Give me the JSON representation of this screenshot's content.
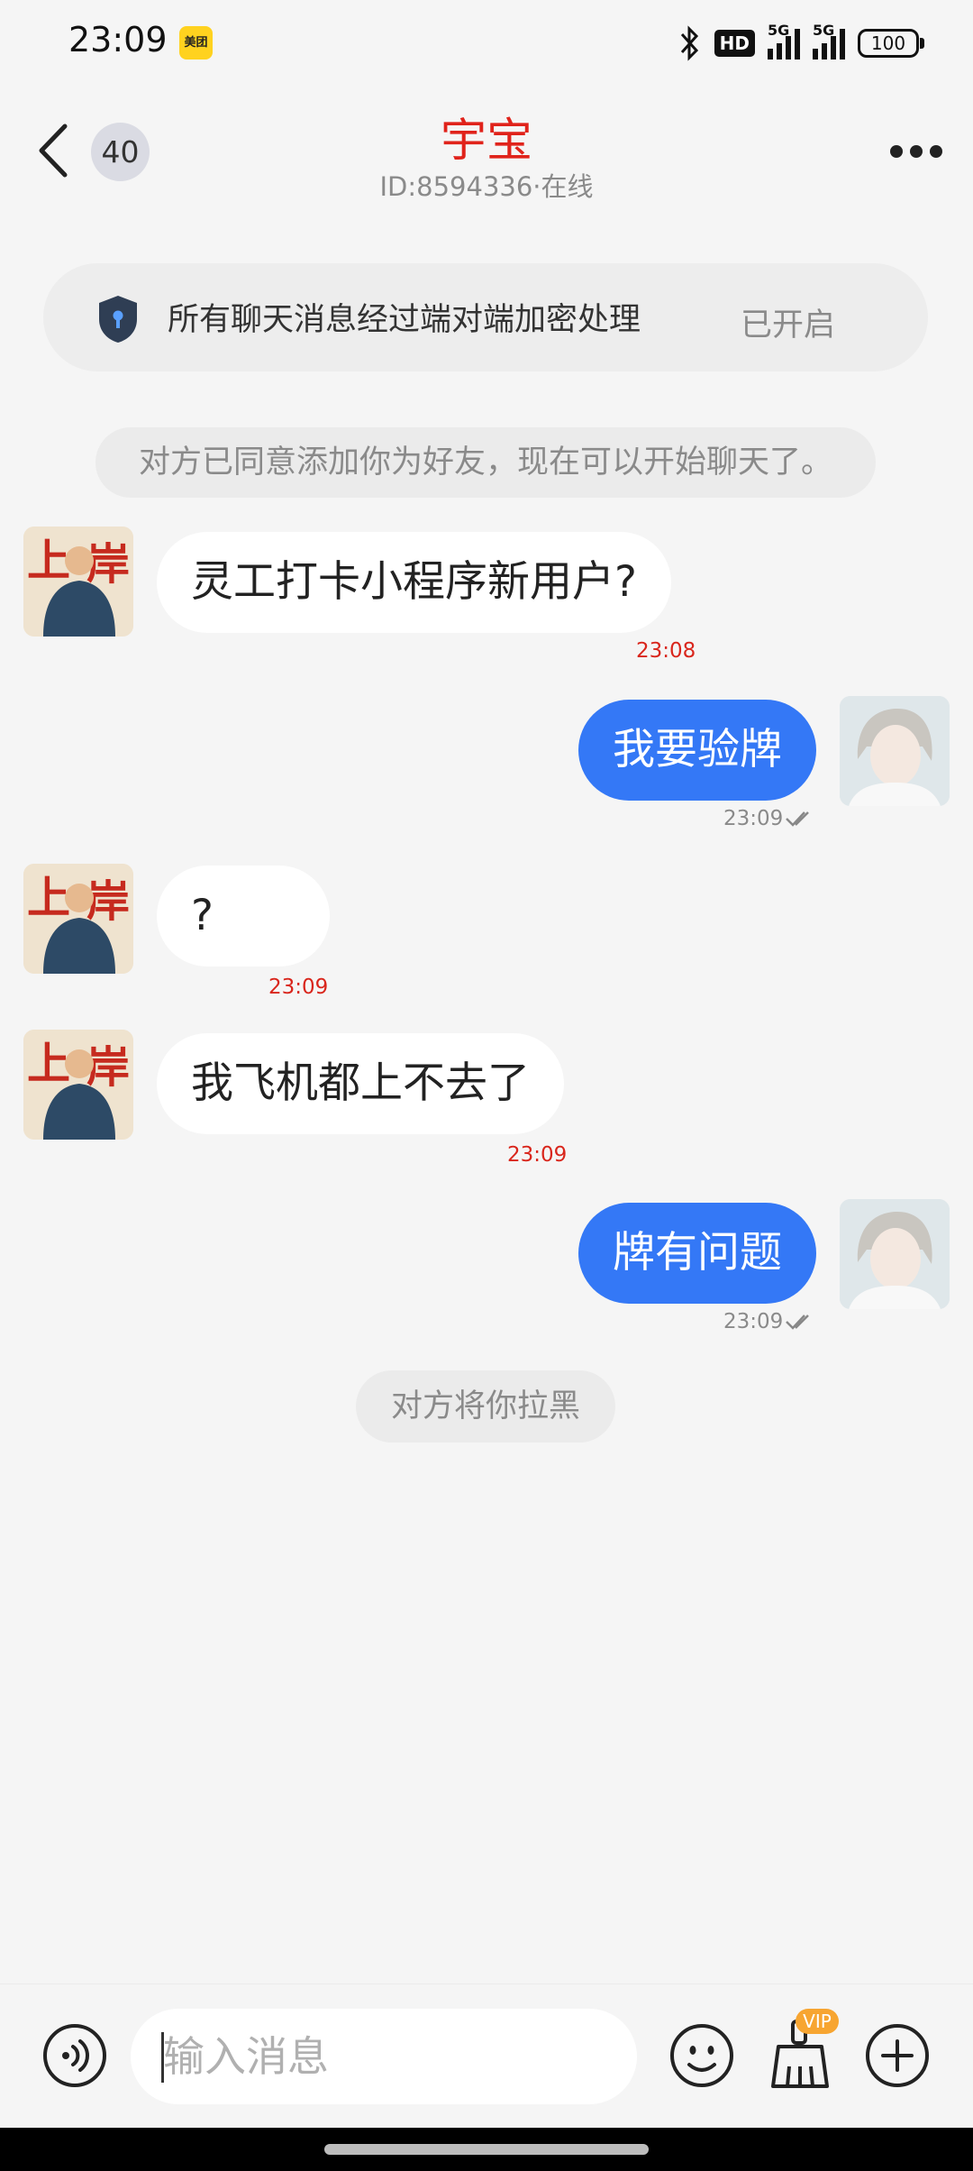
{
  "status_bar": {
    "time": "23:09",
    "app_icon_label": "美团",
    "hd_label": "HD",
    "signal1_label": "5G",
    "signal2_label": "5G",
    "battery": "100"
  },
  "header": {
    "unread_count": "40",
    "title": "宇宝",
    "subtitle": "ID:8594336·在线"
  },
  "encryption_banner": {
    "text": "所有聊天消息经过端对端加密处理",
    "status": "已开启"
  },
  "system_messages": {
    "friend_added": "对方已同意添加你为好友，现在可以开始聊天了。",
    "blocked": "对方将你拉黑"
  },
  "messages": [
    {
      "side": "in",
      "text": "灵工打卡小程序新用户?",
      "time": "23:08"
    },
    {
      "side": "out",
      "text": "我要验牌",
      "time": "23:09"
    },
    {
      "side": "in",
      "text": "?",
      "time": "23:09"
    },
    {
      "side": "in",
      "text": "我飞机都上不去了",
      "time": "23:09"
    },
    {
      "side": "out",
      "text": "牌有问题",
      "time": "23:09"
    }
  ],
  "input_bar": {
    "placeholder": "输入消息",
    "vip_label": "VIP"
  },
  "colors": {
    "accent_red": "#e0231b",
    "bubble_blue": "#3478f6",
    "timestamp_red": "#d9261c"
  },
  "icons": [
    "back-arrow-icon",
    "more-dots-icon",
    "shield-lock-icon",
    "voice-icon",
    "emoji-icon",
    "broom-icon",
    "plus-icon",
    "double-check-icon"
  ]
}
